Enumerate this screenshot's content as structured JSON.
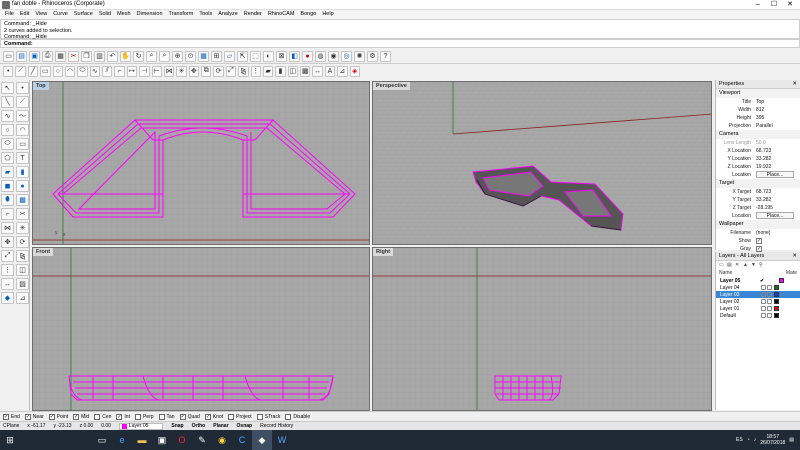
{
  "window": {
    "title": "fan doble - Rhinoceros (Corporate)",
    "controls": [
      "–",
      "☐",
      "✕"
    ]
  },
  "menu": [
    "File",
    "Edit",
    "View",
    "Curve",
    "Surface",
    "Solid",
    "Mesh",
    "Dimension",
    "Transform",
    "Tools",
    "Analyze",
    "Render",
    "RhinoCAM",
    "Bongo",
    "Help"
  ],
  "command_history": [
    "Command: _Hide",
    "2 curves added to selection.",
    "Command: _Hide"
  ],
  "command_prompt": "Command:",
  "viewports": {
    "top": "Top",
    "perspective": "Perspective",
    "front": "Front",
    "right": "Right"
  },
  "properties": {
    "header": "Properties",
    "viewport_section": "Viewport",
    "title_label": "Title",
    "title_value": "Top",
    "width_label": "Width",
    "width_value": "812",
    "height_label": "Height",
    "height_value": "395",
    "projection_label": "Projection",
    "projection_value": "Parallel",
    "camera_section": "Camera",
    "lens_label": "Lens Length",
    "lens_value": "50.0",
    "xloc_label": "X Location",
    "xloc_value": "68.723",
    "yloc_label": "Y Location",
    "yloc_value": "33.282",
    "zloc_label": "Z Location",
    "zloc_value": "19.922",
    "location_label": "Location",
    "place_label": "Place...",
    "target_section": "Target",
    "xtar_label": "X Target",
    "xtar_value": "68.723",
    "ytar_label": "Y Target",
    "ytar_value": "33.282",
    "ztar_label": "Z Target",
    "ztar_value": "-28.195",
    "tlocation_label": "Location",
    "tplace_label": "Place...",
    "wallpaper_section": "Wallpaper",
    "filename_label": "Filename",
    "filename_value": "(none)",
    "show_label": "Show",
    "gray_label": "Gray"
  },
  "layers": {
    "header": "Layers - All Layers",
    "col_name": "Name",
    "col_material": "Mate",
    "rows": [
      {
        "name": "Layer 05",
        "current": "✔",
        "color": "#ff00ff"
      },
      {
        "name": "Layer 04",
        "current": "",
        "color": "#1a6e1a"
      },
      {
        "name": "Layer 03",
        "current": "",
        "color": "#1a3fd0"
      },
      {
        "name": "Layer 02",
        "current": "",
        "color": "#0a0a0a"
      },
      {
        "name": "Layer 01",
        "current": "",
        "color": "#d01010"
      },
      {
        "name": "Default",
        "current": "",
        "color": "#000000"
      }
    ]
  },
  "osnap": [
    {
      "label": "End",
      "checked": true
    },
    {
      "label": "Near",
      "checked": true
    },
    {
      "label": "Point",
      "checked": true
    },
    {
      "label": "Mid",
      "checked": true
    },
    {
      "label": "Cen",
      "checked": false
    },
    {
      "label": "Int",
      "checked": true
    },
    {
      "label": "Perp",
      "checked": false
    },
    {
      "label": "Tan",
      "checked": false
    },
    {
      "label": "Quad",
      "checked": true
    },
    {
      "label": "Knot",
      "checked": true
    },
    {
      "label": "Project",
      "checked": false
    },
    {
      "label": "STrack",
      "checked": false
    },
    {
      "label": "Disable",
      "checked": false
    }
  ],
  "status": {
    "cplane": "CPlane",
    "x": "x -61.17",
    "y": "y -23.13",
    "z": "z 0.00",
    "dist": "0.00",
    "layer": "Layer 05",
    "toggles": [
      "Snap",
      "Ortho",
      "Planar",
      "Osnap",
      "Record History"
    ]
  },
  "taskbar": {
    "time": "18:57",
    "date": "26/07/2018",
    "lang": "ES"
  },
  "colors": {
    "curve": "#ff00ff",
    "grid_bg": "#a7a7a7"
  }
}
